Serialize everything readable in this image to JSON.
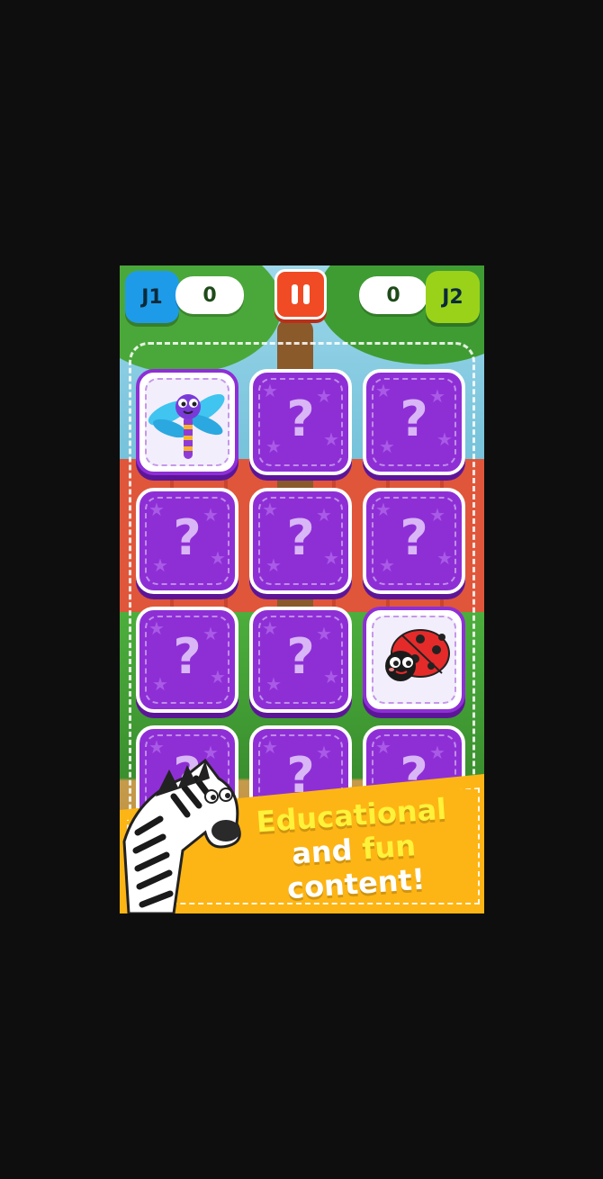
{
  "hud": {
    "player1": {
      "label": "J1",
      "score": "0",
      "color": "#1e9be8"
    },
    "player2": {
      "label": "J2",
      "score": "0",
      "color": "#9ad21a"
    },
    "pause_icon": "pause-icon",
    "pause_color": "#f04b24"
  },
  "board": {
    "rows": 4,
    "columns": 3,
    "hidden_mark": "?",
    "cards": [
      {
        "state": "revealed",
        "picture": "dragonfly"
      },
      {
        "state": "hidden"
      },
      {
        "state": "hidden"
      },
      {
        "state": "hidden"
      },
      {
        "state": "hidden"
      },
      {
        "state": "hidden"
      },
      {
        "state": "hidden"
      },
      {
        "state": "hidden"
      },
      {
        "state": "revealed",
        "picture": "ladybug"
      },
      {
        "state": "hidden"
      },
      {
        "state": "hidden"
      },
      {
        "state": "hidden"
      }
    ],
    "card_color": "#8e2fd6"
  },
  "banner": {
    "line1": "Educational",
    "line2_a": "and",
    "line2_b": "fun",
    "line3": "content!",
    "color": "#fdb515",
    "mascot": "zebra"
  }
}
